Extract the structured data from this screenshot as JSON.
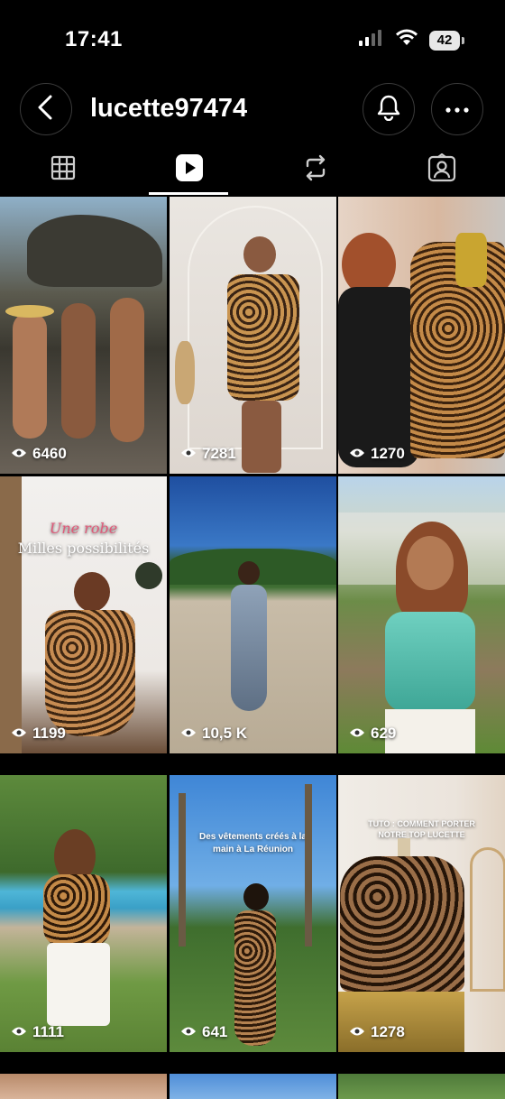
{
  "status_bar": {
    "time": "17:41",
    "battery": "42"
  },
  "header": {
    "username": "lucette97474",
    "back_icon": "chevron-left-icon",
    "bell_icon": "bell-icon",
    "more_icon": "more-horizontal-icon"
  },
  "tabs": [
    {
      "icon": "grid-icon",
      "active": false
    },
    {
      "icon": "reels-icon",
      "active": true
    },
    {
      "icon": "repost-icon",
      "active": false
    },
    {
      "icon": "tagged-icon",
      "active": false
    }
  ],
  "reels": [
    {
      "views": "6460"
    },
    {
      "views": "7281"
    },
    {
      "views": "1270"
    },
    {
      "views": "1199",
      "overlay_title": "Une robe",
      "overlay_sub": "Milles possibilités"
    },
    {
      "views": "10,5 K"
    },
    {
      "views": "629"
    },
    {
      "views": "1111"
    },
    {
      "views": "641",
      "overlay_title": "Des vêtements créés à la main à La Réunion"
    },
    {
      "views": "1278",
      "overlay_title": "TUTO : COMMENT PORTER NOTRE TOP LUCETTE"
    }
  ]
}
